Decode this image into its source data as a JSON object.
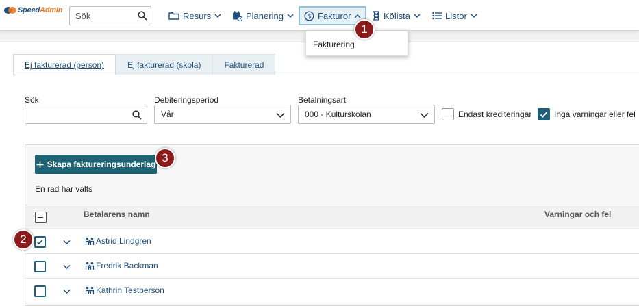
{
  "app": {
    "logo_text_1": "Speed",
    "logo_text_2": "Admin"
  },
  "topbar": {
    "search_placeholder": "Sök",
    "nav": [
      {
        "label": "Resurs",
        "icon": "folder-icon"
      },
      {
        "label": "Planering",
        "icon": "calendar-icon"
      },
      {
        "label": "Fakturor",
        "icon": "dollar-circle-icon"
      },
      {
        "label": "Kölista",
        "icon": "hourglass-icon"
      },
      {
        "label": "Listor",
        "icon": "list-icon"
      }
    ]
  },
  "dropdown": {
    "items": [
      "Fakturering"
    ]
  },
  "badges": [
    "1",
    "2",
    "3"
  ],
  "tabs": [
    "Ej fakturerad (person)",
    "Ej fakturerad (skola)",
    "Fakturerad"
  ],
  "filters": {
    "search_label": "Sök",
    "search_value": "",
    "period_label": "Debiteringsperiod",
    "period_value": "Vår",
    "payment_label": "Betalningsart",
    "payment_value": "000 - Kulturskolan",
    "credit_label": "Endast krediteringar",
    "credit_checked": false,
    "warnings_label": "Inga varningar eller fel",
    "warnings_checked": true
  },
  "actions": {
    "create_label": "Skapa faktureringsunderlag",
    "selection_text": "En rad har valts"
  },
  "grid": {
    "columns": [
      "Betalarens namn",
      "Varningar och fel"
    ],
    "rows": [
      {
        "name": "Astrid Lindgren",
        "checked": true
      },
      {
        "name": "Fredrik Backman",
        "checked": false
      },
      {
        "name": "Kathrin Testperson",
        "checked": false
      }
    ]
  },
  "colors": {
    "primary": "#1f6274",
    "link": "#1f4e7a",
    "badge": "#8b1a1a",
    "accent": "#e87b2a"
  }
}
